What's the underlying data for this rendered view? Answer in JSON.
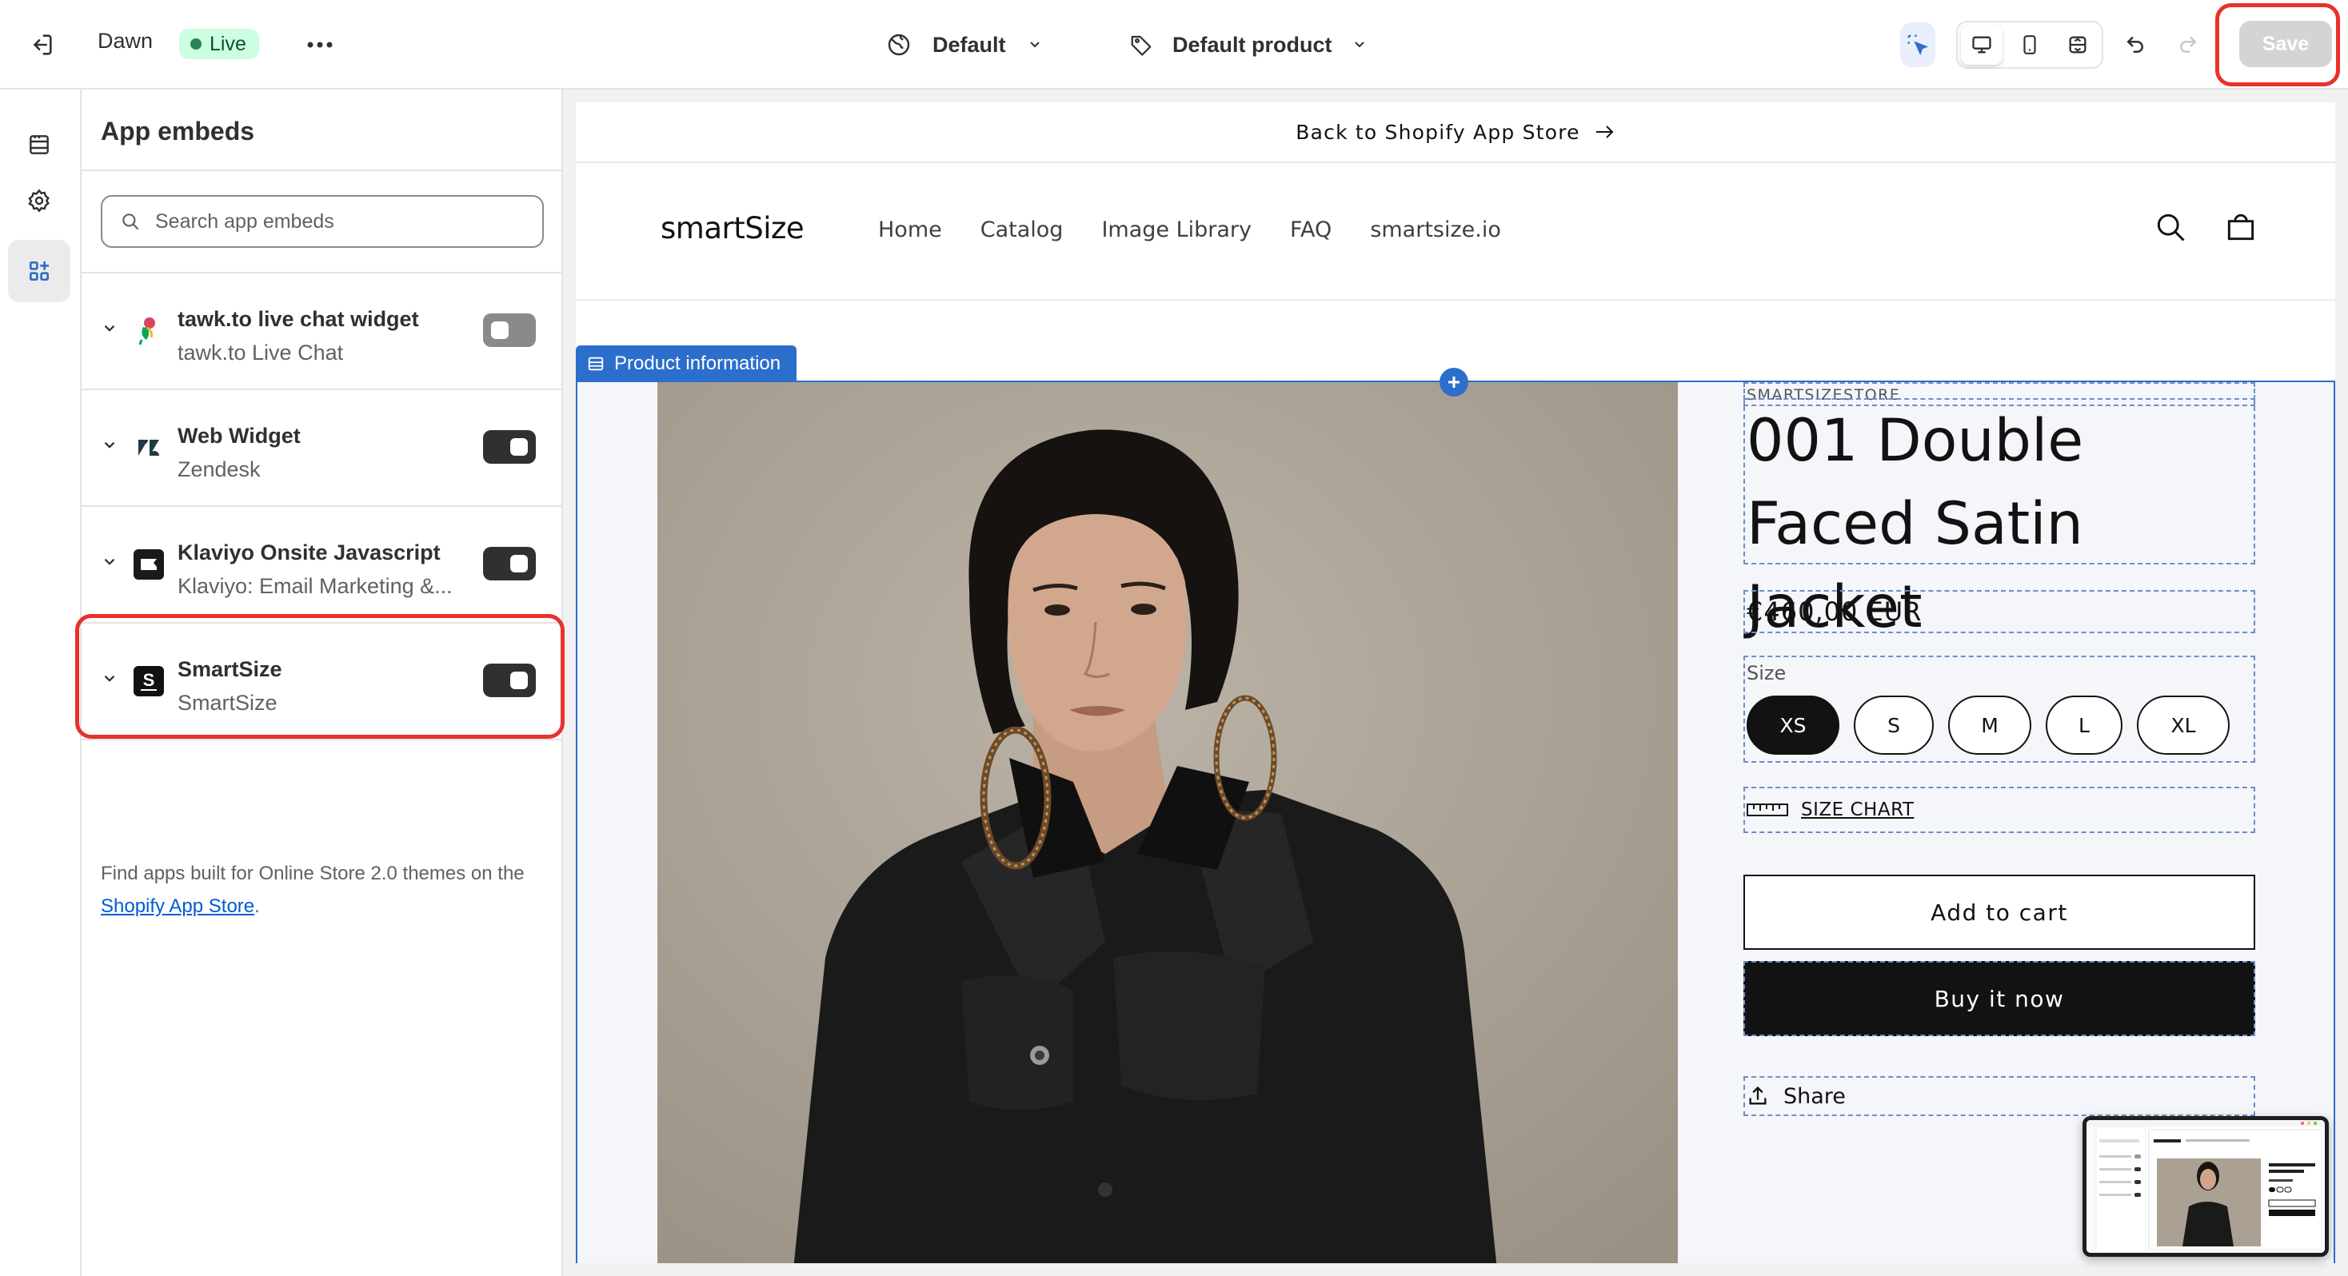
{
  "topbar": {
    "theme_name": "Dawn",
    "status_badge": "Live",
    "preset": "Default",
    "template": "Default product",
    "save_label": "Save"
  },
  "sidebar": {
    "title": "App embeds",
    "search_placeholder": "Search app embeds",
    "embeds": [
      {
        "name": "tawk.to live chat widget",
        "provider": "tawk.to Live Chat",
        "enabled": false,
        "icon": "tawkto-logo-icon"
      },
      {
        "name": "Web Widget",
        "provider": "Zendesk",
        "enabled": true,
        "icon": "zendesk-logo-icon"
      },
      {
        "name": "Klaviyo Onsite Javascript",
        "provider": "Klaviyo: Email Marketing &...",
        "enabled": true,
        "icon": "klaviyo-logo-icon"
      },
      {
        "name": "SmartSize",
        "provider": "SmartSize",
        "enabled": true,
        "icon": "smartsize-logo-icon"
      }
    ],
    "footer_text": "Find apps built for Online Store 2.0 themes on the ",
    "footer_link": "Shopify App Store",
    "footer_end": "."
  },
  "preview": {
    "announcement": "Back to Shopify App Store",
    "store_logo": "smartSize",
    "nav": [
      "Home",
      "Catalog",
      "Image Library",
      "FAQ",
      "smartsize.io"
    ],
    "section_label": "Product information",
    "product": {
      "vendor": "SMARTSIZESTORE",
      "title": "001 Double Faced Satin Jacket",
      "price": "€460,00 EUR",
      "size_label": "Size",
      "sizes": [
        "XS",
        "S",
        "M",
        "L",
        "XL"
      ],
      "selected_size": "XS",
      "size_chart": "SIZE CHART",
      "add_to_cart": "Add to cart",
      "buy_now": "Buy it now",
      "share": "Share"
    },
    "mini_preview": {
      "title": "001 Double Faced Satin Jacket"
    }
  },
  "colors": {
    "accent_blue": "#2c6ecb",
    "highlight_red": "#e8322b",
    "live_badge_bg": "#cdfee1",
    "live_badge_text": "#0c5132",
    "toggle_on": "#303030",
    "buy_now_bg": "#121212"
  }
}
